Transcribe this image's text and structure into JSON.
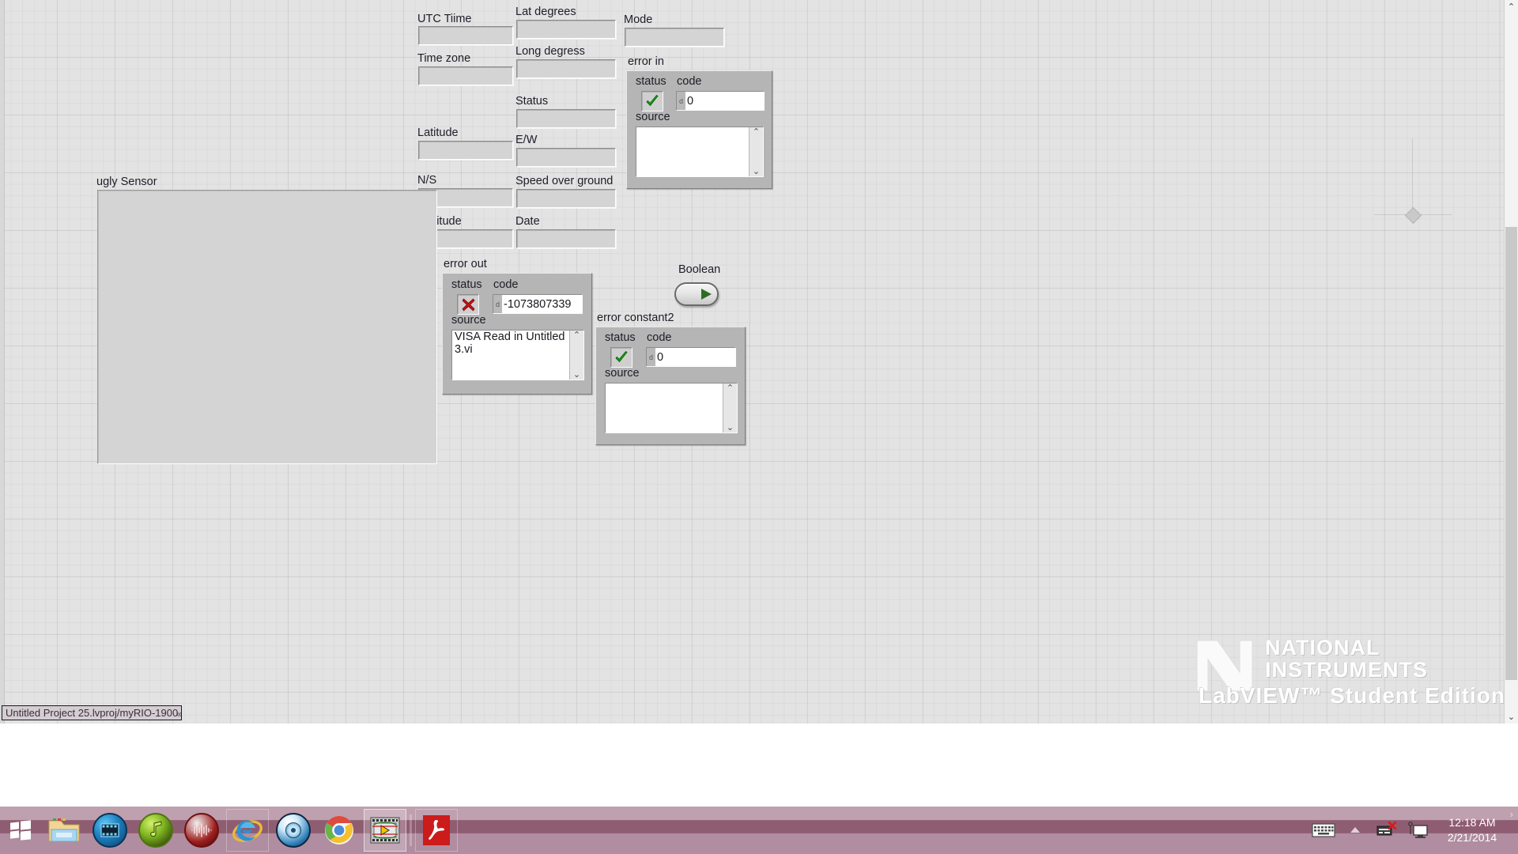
{
  "panel": {
    "controls": [
      {
        "name": "utc-time",
        "label": "UTC Tiime",
        "value": ""
      },
      {
        "name": "time-zone",
        "label": "Time zone",
        "value": ""
      },
      {
        "name": "latitude",
        "label": "Latitude",
        "value": ""
      },
      {
        "name": "ns",
        "label": "N/S",
        "value": ""
      },
      {
        "name": "logitude",
        "label": "Logitude",
        "value": ""
      },
      {
        "name": "lat-degrees",
        "label": "Lat degrees",
        "value": ""
      },
      {
        "name": "long-degress",
        "label": "Long degress",
        "value": ""
      },
      {
        "name": "status-indicator",
        "label": "Status",
        "value": ""
      },
      {
        "name": "ew",
        "label": "E/W",
        "value": ""
      },
      {
        "name": "speed-over-ground",
        "label": "Speed over ground",
        "value": ""
      },
      {
        "name": "date",
        "label": "Date",
        "value": ""
      },
      {
        "name": "mode",
        "label": "Mode",
        "value": ""
      }
    ],
    "ugly_sensor": {
      "label": "ugly Sensor",
      "value": ""
    },
    "boolean": {
      "label": "Boolean",
      "state": "off",
      "led_color": "#2f6b25"
    },
    "error_in": {
      "title": "error in",
      "status_label": "status",
      "code_label": "code",
      "source_label": "source",
      "status": "no-error",
      "status_icon": "green-check-icon",
      "radix": "d",
      "code": "0",
      "source": ""
    },
    "error_out": {
      "title": "error out",
      "status_label": "status",
      "code_label": "code",
      "source_label": "source",
      "status": "error",
      "status_icon": "red-x-icon",
      "radix": "d",
      "code": "-1073807339",
      "source": "VISA Read in Untitled 3.vi"
    },
    "error_constant2": {
      "title": "error constant2",
      "status_label": "status",
      "code_label": "code",
      "source_label": "source",
      "status": "no-error",
      "status_icon": "green-check-icon",
      "radix": "d",
      "code": "0",
      "source": ""
    },
    "watermark": {
      "line1": "NATIONAL",
      "line2": "INSTRUMENTS",
      "line3": "LabVIEW™ Student Edition"
    },
    "scrollbar": {
      "up_arrow": "⌃",
      "down_arrow": "⌄"
    }
  },
  "status_bar": {
    "text": "Untitled Project 25.lvproj/myRIO-1900",
    "grip": "«"
  },
  "taskbar": {
    "start_label": "Start",
    "items": [
      {
        "name": "file-explorer",
        "icon": "folder-icon",
        "active": false,
        "framed": false
      },
      {
        "name": "media-player",
        "icon": "film-reel-icon",
        "active": false,
        "framed": false
      },
      {
        "name": "music-player",
        "icon": "music-note-icon",
        "active": false,
        "framed": false
      },
      {
        "name": "audio-editor",
        "icon": "waveform-icon",
        "active": false,
        "framed": false
      },
      {
        "name": "internet-explorer",
        "icon": "ie-icon",
        "active": false,
        "framed": true
      },
      {
        "name": "disc-burner",
        "icon": "disc-icon",
        "active": false,
        "framed": false
      },
      {
        "name": "google-chrome",
        "icon": "chrome-icon",
        "active": false,
        "framed": false
      },
      {
        "name": "labview",
        "icon": "labview-icon",
        "active": true,
        "framed": false
      },
      {
        "name": "adobe-acrobat",
        "icon": "acrobat-icon",
        "active": false,
        "framed": true
      }
    ],
    "tray": {
      "expand": "›",
      "icons": [
        {
          "name": "touch-keyboard-icon"
        },
        {
          "name": "show-hidden-icons-chevron"
        },
        {
          "name": "network-disconnected-icon"
        },
        {
          "name": "remote-display-icon"
        }
      ],
      "time": "12:18 AM",
      "date": "2/21/2014"
    }
  }
}
